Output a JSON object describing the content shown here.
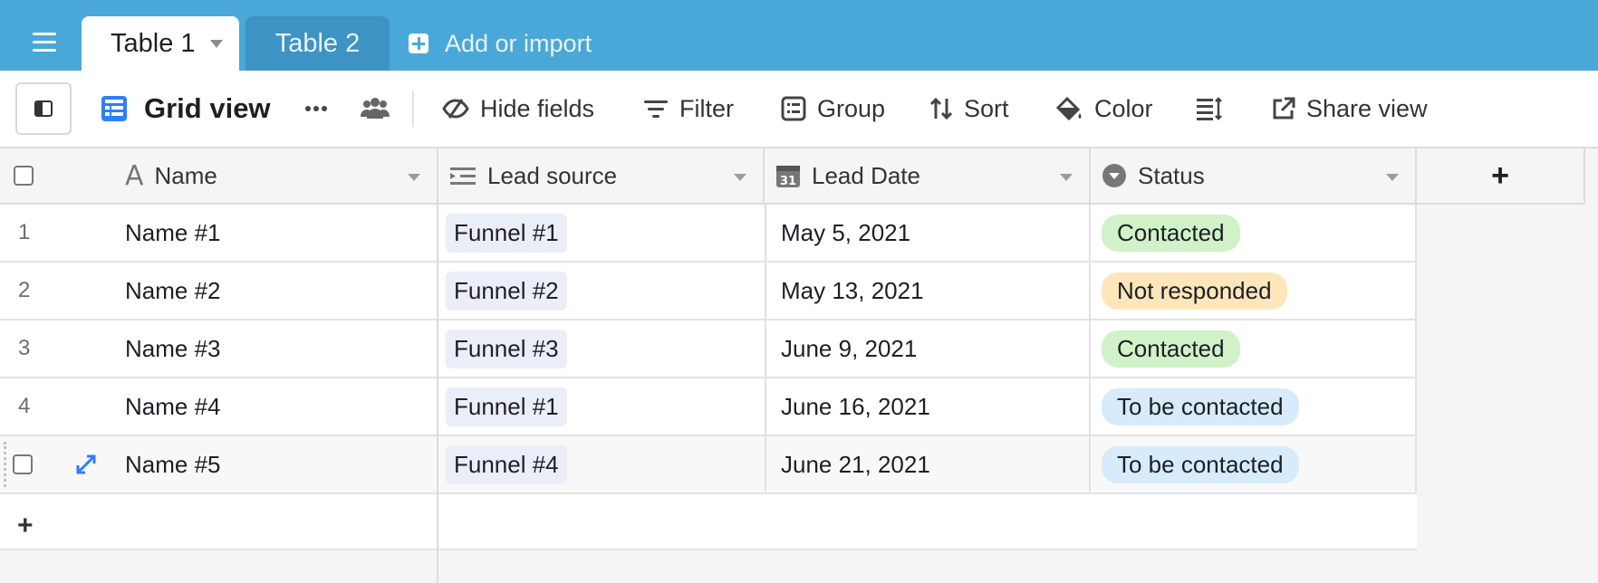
{
  "tabs": {
    "active": "Table 1",
    "inactive": "Table 2",
    "add_import": "Add or import"
  },
  "toolbar": {
    "view_name": "Grid view",
    "hide_fields": "Hide fields",
    "filter": "Filter",
    "group": "Group",
    "sort": "Sort",
    "color": "Color",
    "share_view": "Share view"
  },
  "columns": {
    "name": "Name",
    "lead_source": "Lead source",
    "lead_date": "Lead Date",
    "status": "Status"
  },
  "calendar_icon_day": "31",
  "rows": [
    {
      "num": "1",
      "name": "Name #1",
      "source": "Funnel #1",
      "date": "May 5, 2021",
      "status": "Contacted"
    },
    {
      "num": "2",
      "name": "Name #2",
      "source": "Funnel #2",
      "date": "May 13, 2021",
      "status": "Not responded"
    },
    {
      "num": "3",
      "name": "Name #3",
      "source": "Funnel #3",
      "date": "June 9, 2021",
      "status": "Contacted"
    },
    {
      "num": "4",
      "name": "Name #4",
      "source": "Funnel #1",
      "date": "June 16, 2021",
      "status": "To be contacted"
    },
    {
      "num": "",
      "name": "Name #5",
      "source": "Funnel #4",
      "date": "June 21, 2021",
      "status": "To be contacted"
    }
  ],
  "colors": {
    "header_blue": "#4aa8d8",
    "status_contacted": "#d1f2c8",
    "status_not_responded": "#fde6b9",
    "status_to_be_contacted": "#d7ebfa",
    "accent_blue": "#2d7ff9"
  }
}
